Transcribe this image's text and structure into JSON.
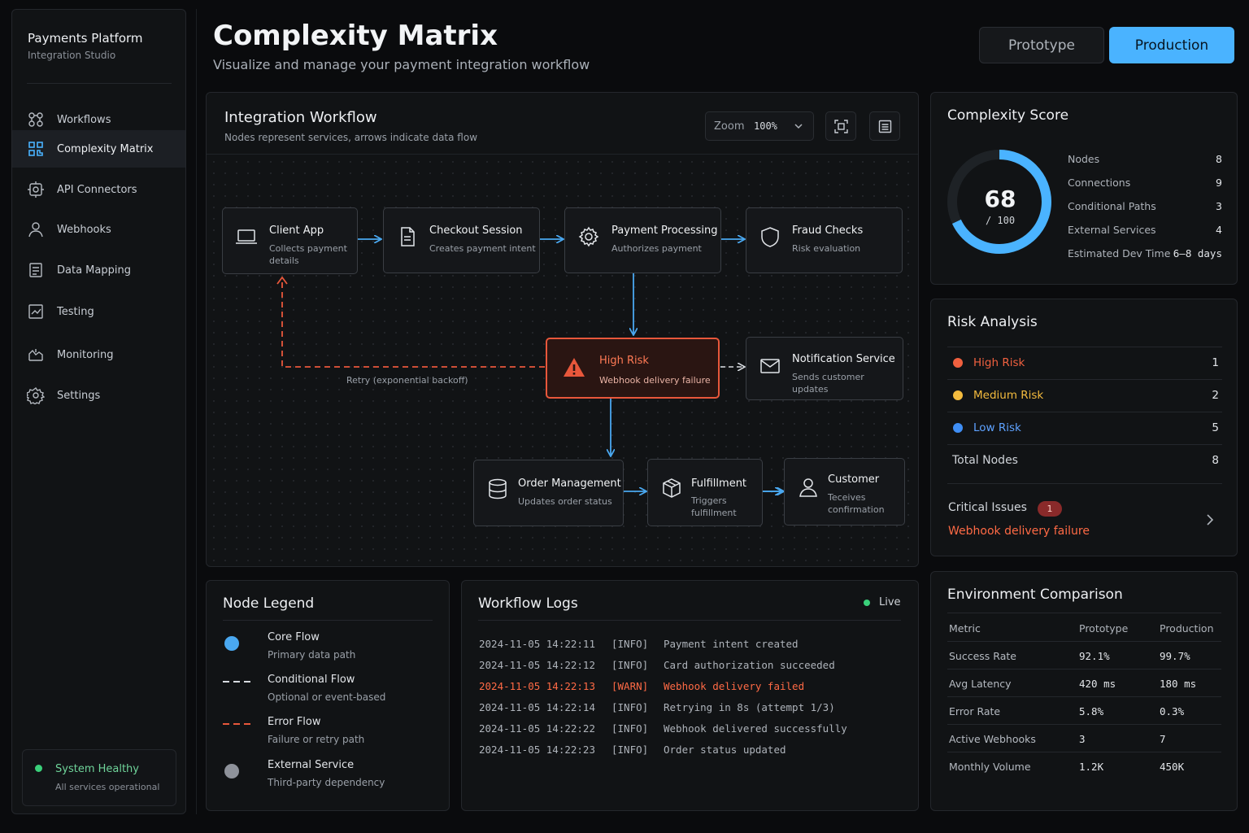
{
  "sidebar": {
    "brand_title": "Payments Platform",
    "brand_subtitle": "Integration Studio",
    "items": [
      {
        "label": "Workflows",
        "icon": "workflow-icon"
      },
      {
        "label": "Complexity Matrix",
        "icon": "grid-icon",
        "active": true
      },
      {
        "label": "API Connectors",
        "icon": "connector-icon"
      },
      {
        "label": "Webhooks",
        "icon": "webhook-icon"
      },
      {
        "label": "Data Mapping",
        "icon": "mapping-icon"
      },
      {
        "label": "Testing",
        "icon": "testing-icon"
      },
      {
        "label": "Monitoring",
        "icon": "monitoring-icon"
      },
      {
        "label": "Settings",
        "icon": "gear-icon"
      }
    ],
    "health_title": "System Healthy",
    "health_subtitle": "All services operational"
  },
  "header": {
    "title": "Complexity Matrix",
    "subtitle": "Visualize and manage your payment integration workflow",
    "env_prototype": "Prototype",
    "env_production": "Production",
    "active_env": "Production"
  },
  "workflow": {
    "title": "Integration Workflow",
    "subtitle": "Nodes represent services, arrows indicate data flow",
    "zoom_label": "Zoom",
    "zoom_value": "100%",
    "retry_label": "Retry (exponential backoff)",
    "nodes": {
      "client": {
        "title": "Client App",
        "desc": "Collects payment details"
      },
      "checkout": {
        "title": "Checkout Session",
        "desc": "Creates payment intent"
      },
      "payment": {
        "title": "Payment Processing",
        "desc": "Authorizes payment"
      },
      "fraud": {
        "title": "Fraud Checks",
        "desc": "Risk evaluation"
      },
      "risk": {
        "title": "High Risk",
        "desc": "Webhook delivery failure"
      },
      "notify": {
        "title": "Notification Service",
        "desc": "Sends customer updates"
      },
      "order": {
        "title": "Order Management",
        "desc": "Updates order status"
      },
      "fulfill": {
        "title": "Fulfillment",
        "desc": "Triggers fulfillment"
      },
      "customer": {
        "title": "Customer",
        "desc": "Teceives confirmation"
      }
    }
  },
  "legend": {
    "title": "Node Legend",
    "items": [
      {
        "title": "Core Flow",
        "desc": "Primary data path"
      },
      {
        "title": "Conditional Flow",
        "desc": "Optional or event-based"
      },
      {
        "title": "Error Flow",
        "desc": "Failure or retry path"
      },
      {
        "title": "External Service",
        "desc": "Third-party dependency"
      }
    ]
  },
  "logs": {
    "title": "Workflow Logs",
    "live_label": "Live",
    "rows": [
      {
        "time": "2024-11-05 14:22:11",
        "level": "[INFO]",
        "msg": "Payment intent created"
      },
      {
        "time": "2024-11-05 14:22:12",
        "level": "[INFO]",
        "msg": "Card authorization succeeded"
      },
      {
        "time": "2024-11-05 14:22:13",
        "level": "[WARN]",
        "msg": "Webhook delivery failed"
      },
      {
        "time": "2024-11-05 14:22:14",
        "level": "[INFO]",
        "msg": "Retrying in 8s (attempt 1/3)"
      },
      {
        "time": "2024-11-05 14:22:22",
        "level": "[INFO]",
        "msg": "Webhook delivered successfully"
      },
      {
        "time": "2024-11-05 14:22:23",
        "level": "[INFO]",
        "msg": "Order status updated"
      }
    ]
  },
  "score": {
    "title": "Complexity Score",
    "value": "68",
    "max_label": "/ 100",
    "fraction": 0.68,
    "stats": [
      {
        "label": "Nodes",
        "value": "8"
      },
      {
        "label": "Connections",
        "value": "9"
      },
      {
        "label": "Conditional Paths",
        "value": "3"
      },
      {
        "label": "External Services",
        "value": "4"
      },
      {
        "label": "Estimated Dev Time",
        "value": "6–8 days"
      }
    ]
  },
  "risk": {
    "title": "Risk Analysis",
    "rows": [
      {
        "label": "High Risk",
        "value": "1",
        "color": "#f0603f"
      },
      {
        "label": "Medium Risk",
        "value": "2",
        "color": "#f4bb3e"
      },
      {
        "label": "Low Risk",
        "value": "5",
        "color": "#3f8ef5"
      }
    ],
    "total_label": "Total Nodes",
    "total_value": "8",
    "critical_label": "Critical Issues",
    "critical_count": "1",
    "critical_desc": "Webhook delivery failure"
  },
  "env": {
    "title": "Environment Comparison",
    "headers": [
      "Metric",
      "Prototype",
      "Production"
    ],
    "rows": [
      [
        "Success Rate",
        "92.1%",
        "99.7%"
      ],
      [
        "Avg Latency",
        "420 ms",
        "180 ms"
      ],
      [
        "Error Rate",
        "5.8%",
        "0.3%"
      ],
      [
        "Active Webhooks",
        "3",
        "7"
      ],
      [
        "Monthly Volume",
        "1.2K",
        "450K"
      ]
    ]
  },
  "colors": {
    "accent": "#4ab3ff",
    "error": "#e8573b",
    "success": "#3ad07a"
  }
}
